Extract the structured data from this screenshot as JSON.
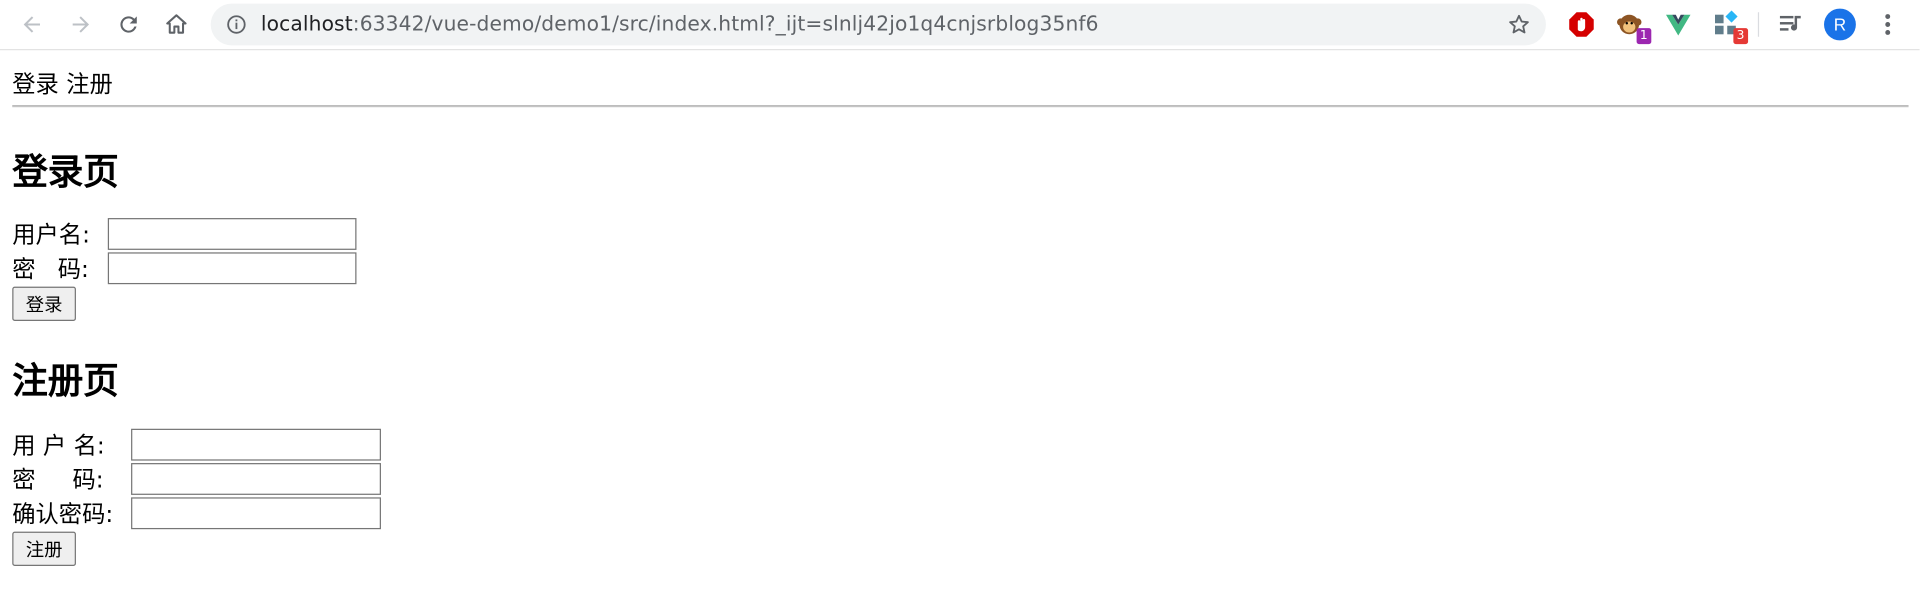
{
  "browser": {
    "url_host": "localhost",
    "url_rest": ":63342/vue-demo/demo1/src/index.html?_ijt=slnlj42jo1q4cnjsrblog35nf6",
    "avatar_letter": "R",
    "extensions": [
      {
        "name": "adblock",
        "badge": ""
      },
      {
        "name": "tampermonkey",
        "badge": "1",
        "badge_color": "#9c27b0"
      },
      {
        "name": "vue-devtools",
        "badge": ""
      },
      {
        "name": "extension-puzzle",
        "badge": "3",
        "badge_color": "#e53935"
      }
    ]
  },
  "page": {
    "nav": {
      "login": "登录",
      "register": "注册"
    },
    "login": {
      "title": "登录页",
      "username_label": "用户名:",
      "password_label": "密   码:",
      "username_value": "",
      "password_value": "",
      "button": "登录"
    },
    "register": {
      "title": "注册页",
      "username_label": "用 户 名:",
      "password_label": "密     码:",
      "confirm_label": "确认密码:",
      "username_value": "",
      "password_value": "",
      "confirm_value": "",
      "button": "注册"
    }
  }
}
